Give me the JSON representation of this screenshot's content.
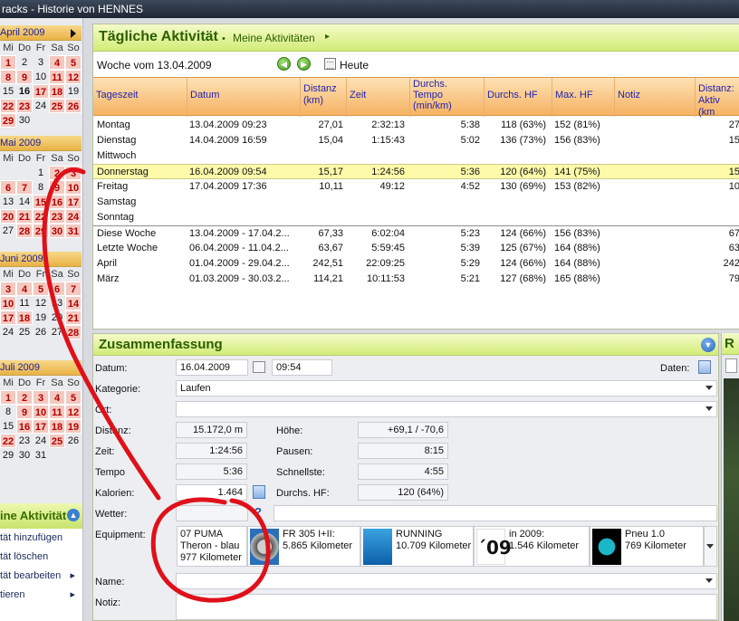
{
  "window": {
    "title": "racks - Historie von HENNES"
  },
  "colors": {
    "accent_green": "#d2ec78",
    "header_orange": "#f6b262",
    "activity_day": "#f3c9c0",
    "selected_row": "#fdfaa9",
    "annotation": "#e0101a"
  },
  "calendars": [
    {
      "month": "April 2009",
      "dow": [
        "Mi",
        "Do",
        "Fr",
        "Sa",
        "So"
      ],
      "days": [
        [
          "1",
          "2",
          "3",
          "4",
          "5"
        ],
        [
          "8",
          "9",
          "10",
          "11",
          "12"
        ],
        [
          "15",
          "16",
          "17",
          "18",
          "19"
        ],
        [
          "22",
          "23",
          "24",
          "25",
          "26"
        ],
        [
          "29",
          "30",
          "",
          "",
          ""
        ]
      ]
    },
    {
      "month": "Mai 2009",
      "dow": [
        "Mi",
        "Do",
        "Fr",
        "Sa",
        "So"
      ],
      "days": [
        [
          "",
          "",
          "1",
          "2",
          "3"
        ],
        [
          "6",
          "7",
          "8",
          "9",
          "10"
        ],
        [
          "13",
          "14",
          "15",
          "16",
          "17"
        ],
        [
          "20",
          "21",
          "22",
          "23",
          "24"
        ],
        [
          "27",
          "28",
          "29",
          "30",
          "31"
        ]
      ]
    },
    {
      "month": "Juni 2009",
      "dow": [
        "Mi",
        "Do",
        "Fr",
        "Sa",
        "So"
      ],
      "days": [
        [
          "3",
          "4",
          "5",
          "6",
          "7"
        ],
        [
          "10",
          "11",
          "12",
          "13",
          "14"
        ],
        [
          "17",
          "18",
          "19",
          "20",
          "21"
        ],
        [
          "24",
          "25",
          "26",
          "27",
          "28"
        ]
      ]
    },
    {
      "month": "Juli 2009",
      "dow": [
        "Mi",
        "Do",
        "Fr",
        "Sa",
        "So"
      ],
      "days": [
        [
          "1",
          "2",
          "3",
          "4",
          "5"
        ],
        [
          "8",
          "9",
          "10",
          "11",
          "12"
        ],
        [
          "15",
          "16",
          "17",
          "18",
          "19"
        ],
        [
          "22",
          "23",
          "24",
          "25",
          "26"
        ],
        [
          "29",
          "30",
          "31",
          "",
          ""
        ]
      ]
    }
  ],
  "sidebar": {
    "title": "ine Aktivität",
    "items": [
      {
        "label": "tät hinzufügen",
        "arrow": ""
      },
      {
        "label": "tät löschen",
        "arrow": ""
      },
      {
        "label": "tät bearbeiten",
        "arrow": "▸"
      },
      {
        "label": "tieren",
        "arrow": "▸"
      }
    ]
  },
  "main": {
    "title": "Tägliche Aktivität",
    "bullet": "•",
    "subtitle": "Meine Aktivitäten",
    "subtitle_arrow": "▸",
    "week_label": "Woche vom 13.04.2009",
    "prev_icon": "◀",
    "next_icon": "▶",
    "today_label": "Heute",
    "columns": {
      "tageszeit": "Tageszeit",
      "datum": "Datum",
      "distanz": [
        "Distanz",
        "(km)"
      ],
      "zeit": "Zeit",
      "tempo": [
        "Durchs.",
        "Tempo",
        "(min/km)"
      ],
      "hf": "Durchs. HF",
      "maxhf": "Max. HF",
      "notiz": "Notiz",
      "aktiv": [
        "Distanz:",
        "Aktiv (km"
      ]
    },
    "rows": [
      {
        "tz": "Montag",
        "dt": "13.04.2009 09:23",
        "di": "27,01",
        "ze": "2:32:13",
        "te": "5:38",
        "hf": "118 (63%)",
        "mh": "152 (81%)",
        "no": "",
        "da": "27"
      },
      {
        "tz": "Dienstag",
        "dt": "14.04.2009 16:59",
        "di": "15,04",
        "ze": "1:15:43",
        "te": "5:02",
        "hf": "136 (73%)",
        "mh": "156 (83%)",
        "no": "",
        "da": "15"
      },
      {
        "tz": "Mittwoch",
        "dt": "",
        "di": "",
        "ze": "",
        "te": "",
        "hf": "",
        "mh": "",
        "no": "",
        "da": ""
      },
      {
        "tz": "Donnerstag",
        "dt": "16.04.2009 09:54",
        "di": "15,17",
        "ze": "1:24:56",
        "te": "5:36",
        "hf": "120 (64%)",
        "mh": "141 (75%)",
        "no": "",
        "da": "15"
      },
      {
        "tz": "Freitag",
        "dt": "17.04.2009 17:36",
        "di": "10,11",
        "ze": "49:12",
        "te": "4:52",
        "hf": "130 (69%)",
        "mh": "153 (82%)",
        "no": "",
        "da": "10"
      },
      {
        "tz": "Samstag",
        "dt": "",
        "di": "",
        "ze": "",
        "te": "",
        "hf": "",
        "mh": "",
        "no": "",
        "da": ""
      },
      {
        "tz": "Sonntag",
        "dt": "",
        "di": "",
        "ze": "",
        "te": "",
        "hf": "",
        "mh": "",
        "no": "",
        "da": ""
      },
      {
        "tz": "Diese Woche",
        "dt": "13.04.2009 - 17.04.2...",
        "di": "67,33",
        "ze": "6:02:04",
        "te": "5:23",
        "hf": "124 (66%)",
        "mh": "156 (83%)",
        "no": "",
        "da": "67"
      },
      {
        "tz": "Letzte Woche",
        "dt": "06.04.2009 - 11.04.2...",
        "di": "63,67",
        "ze": "5:59:45",
        "te": "5:39",
        "hf": "125 (67%)",
        "mh": "164 (88%)",
        "no": "",
        "da": "63"
      },
      {
        "tz": "April",
        "dt": "01.04.2009 - 29.04.2...",
        "di": "242,51",
        "ze": "22:09:25",
        "te": "5:29",
        "hf": "124 (66%)",
        "mh": "164 (88%)",
        "no": "",
        "da": "242"
      },
      {
        "tz": "März",
        "dt": "01.03.2009 - 30.03.2...",
        "di": "114,21",
        "ze": "10:11:53",
        "te": "5:21",
        "hf": "127 (68%)",
        "mh": "165 (88%)",
        "no": "",
        "da": "79"
      }
    ]
  },
  "summary": {
    "title": "Zusammenfassung",
    "toggle_icon": "▼",
    "datum_label": "Datum:",
    "datum_value": "16.04.2009",
    "uhrzeit_value": "09:54",
    "daten_label": "Daten:",
    "kategorie_label": "Kategorie:",
    "kategorie_value": "Laufen",
    "ort_label": "Ort:",
    "ort_value": "",
    "distanz_label": "Distanz:",
    "distanz_value": "15.172,0 m",
    "zeit_label": "Zeit:",
    "zeit_value": "1:24:56",
    "tempo_label": "Tempo",
    "tempo_value": "5:36",
    "kalorien_label": "Kalorien:",
    "kalorien_value": "1.464",
    "hoehe_label": "Höhe:",
    "hoehe_value": "+69,1 / -70,6",
    "pausen_label": "Pausen:",
    "pausen_value": "8:15",
    "schnellste_label": "Schnellste:",
    "schnellste_value": "4:55",
    "hf_label": "Durchs. HF:",
    "hf_value": "120 (64%)",
    "wetter_label": "Wetter:",
    "wetter_help": "?",
    "equipment_label": "Equipment:",
    "equipment": [
      {
        "line1": "07 PUMA",
        "line2": "Theron - blau",
        "line3": "977 Kilometer"
      },
      {
        "line1": "FR 305 I+II:",
        "line2": "5.865 Kilometer",
        "line3": ""
      },
      {
        "line1": "RUNNING",
        "line2": "10.709 Kilometer",
        "line3": ""
      },
      {
        "badge": "´09",
        "line1": "in 2009:",
        "line2": "1.546 Kilometer",
        "line3": ""
      },
      {
        "line1": "Pneu 1.0",
        "line2": "769 Kilometer",
        "line3": ""
      }
    ],
    "name_label": "Name:",
    "name_value": "",
    "notiz_label": "Notiz:",
    "notiz_value": ""
  },
  "right_panel": {
    "title": "R"
  }
}
